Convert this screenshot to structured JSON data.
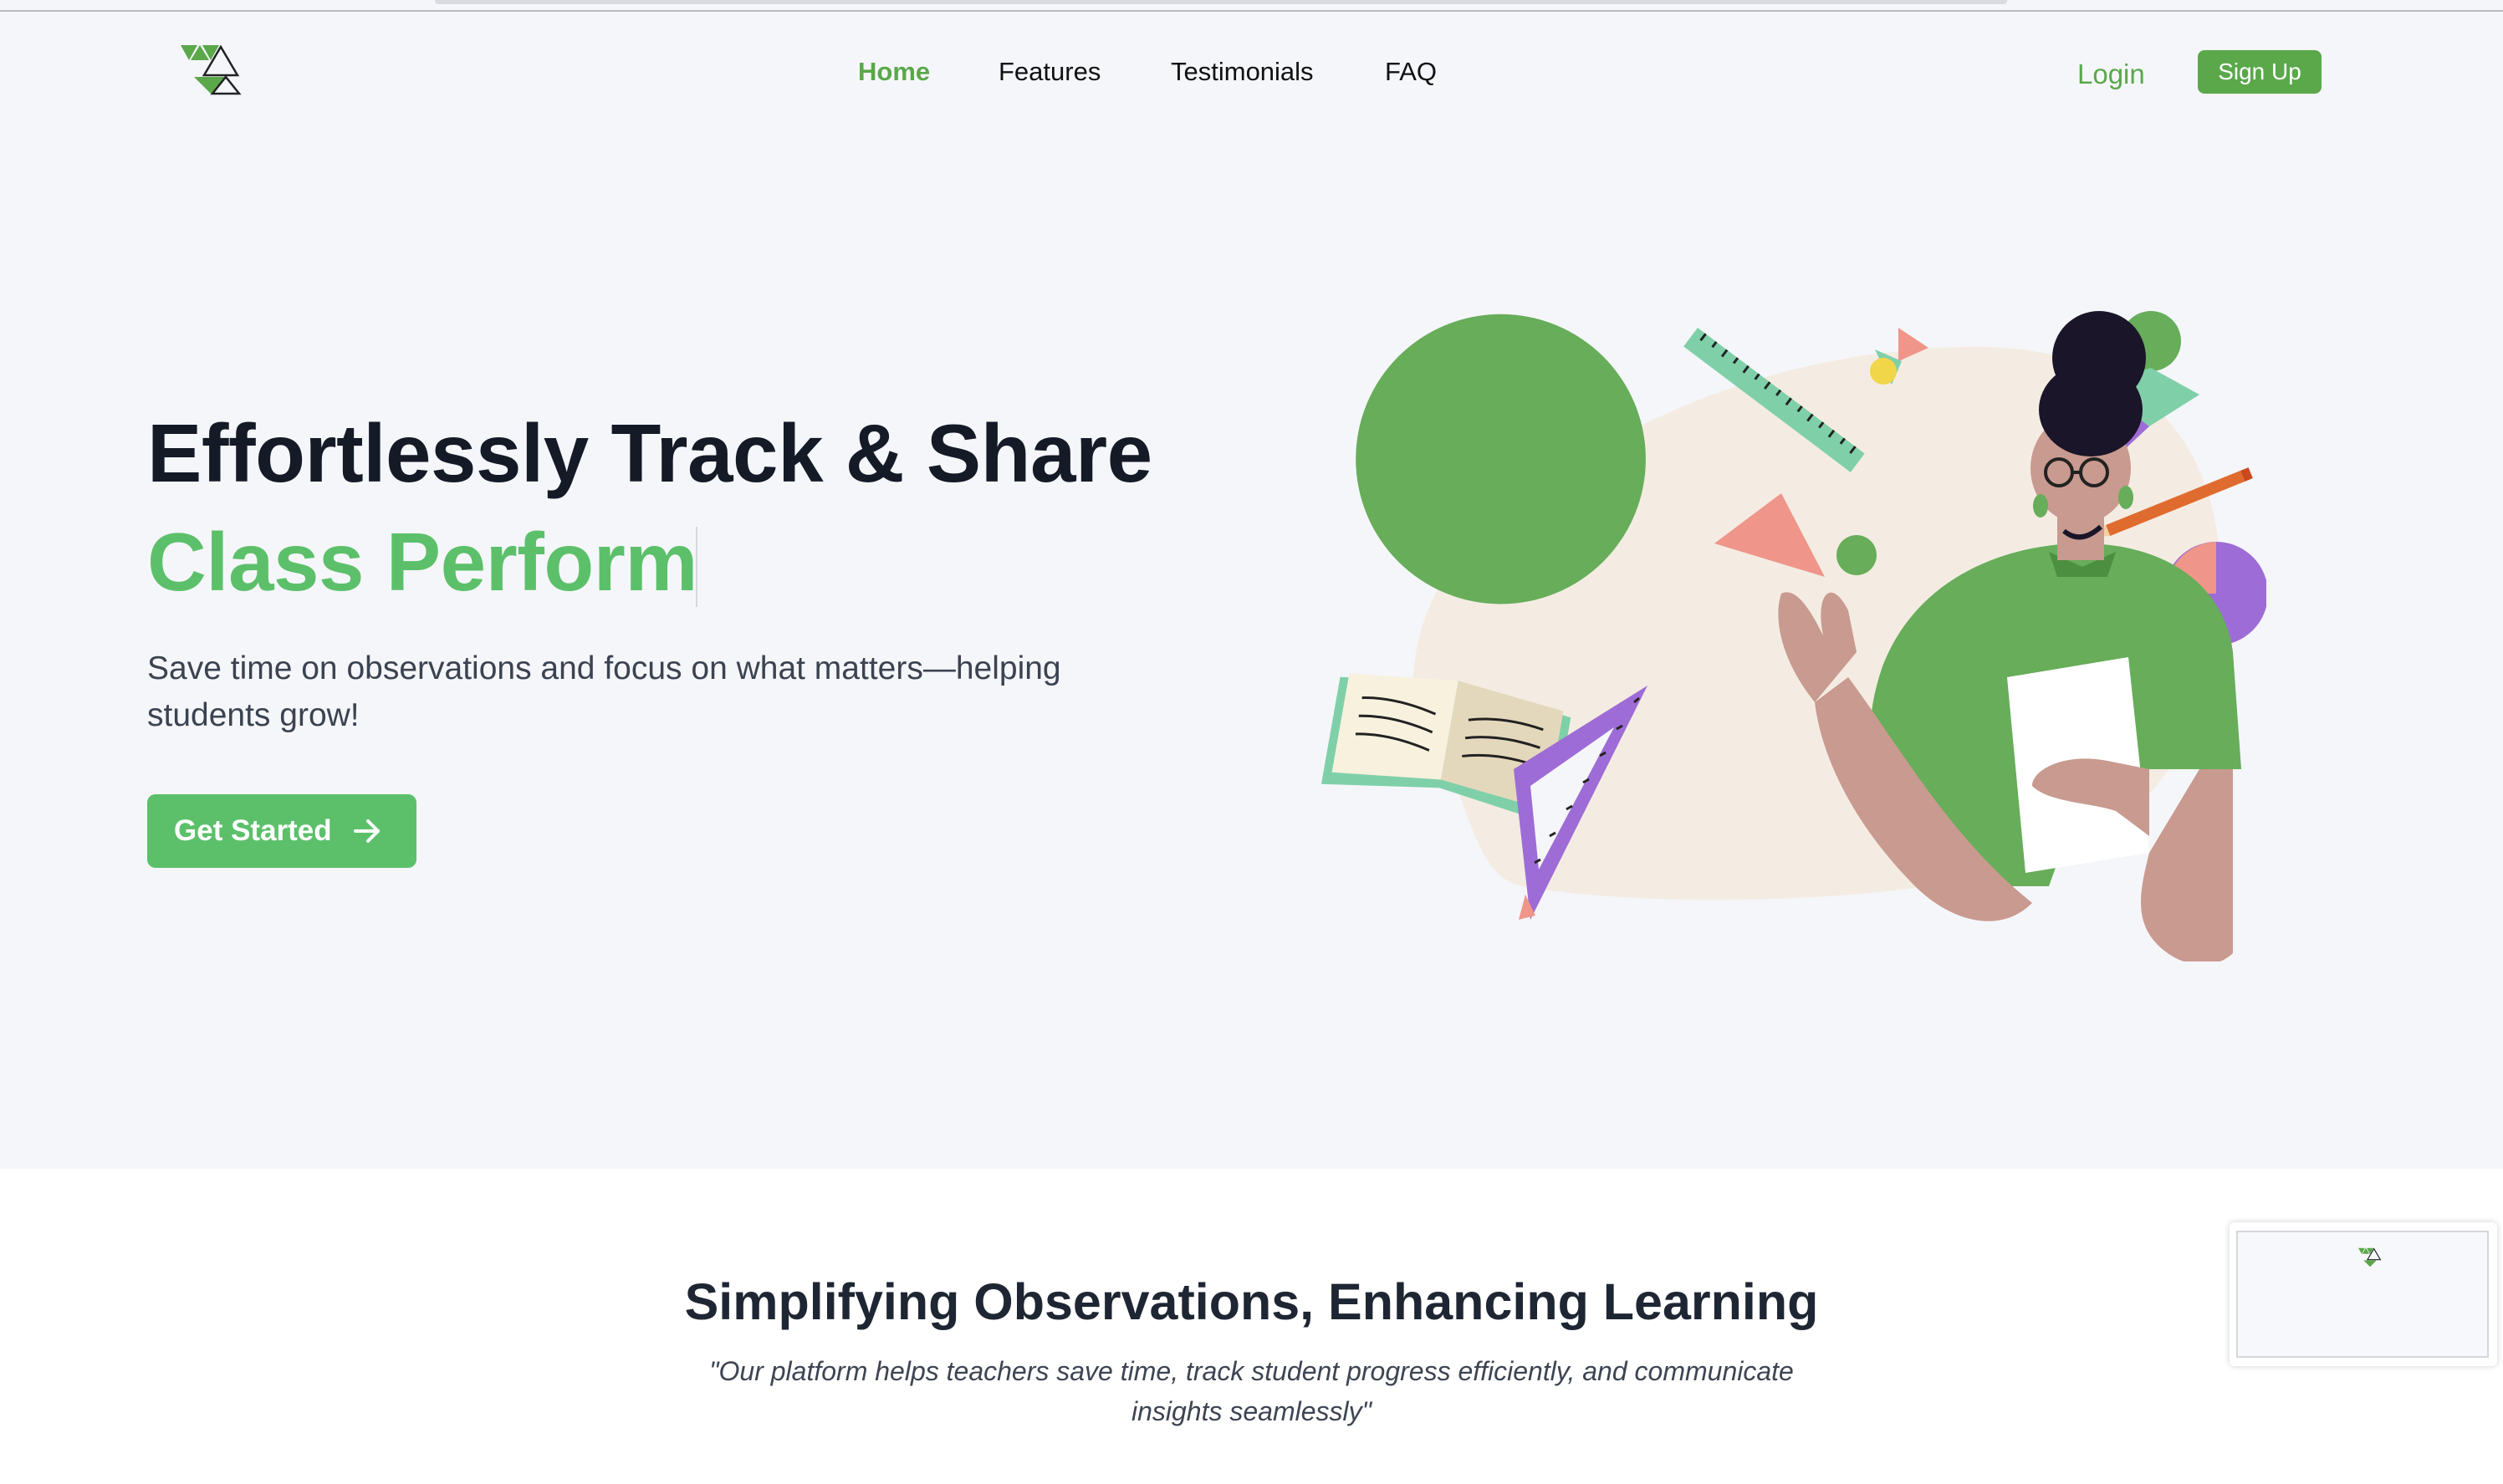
{
  "nav": {
    "logo_icon": "triangle-logo-icon",
    "items": [
      {
        "label": "Home",
        "active": true
      },
      {
        "label": "Features",
        "active": false
      },
      {
        "label": "Testimonials",
        "active": false
      },
      {
        "label": "FAQ",
        "active": false
      }
    ],
    "login_label": "Login",
    "signup_label": "Sign Up"
  },
  "hero": {
    "title_line1": "Effortlessly Track & Share",
    "title_line2": "Class Perform",
    "subtitle": "Save time on observations and focus on what matters—helping students grow!",
    "cta_label": "Get Started",
    "cta_icon": "arrow-right-icon",
    "illustration": "teacher-illustration"
  },
  "section": {
    "title": "Simplifying Observations, Enhancing Learning",
    "quote": "\"Our platform helps teachers save time, track student progress efficiently, and communicate insights seamlessly\""
  },
  "widget": {
    "logo_icon": "triangle-logo-icon"
  },
  "colors": {
    "brand_green": "#5aa84a",
    "accent_green": "#5cc06a",
    "heading_dark": "#141a26",
    "background": "#f5f6fa"
  }
}
